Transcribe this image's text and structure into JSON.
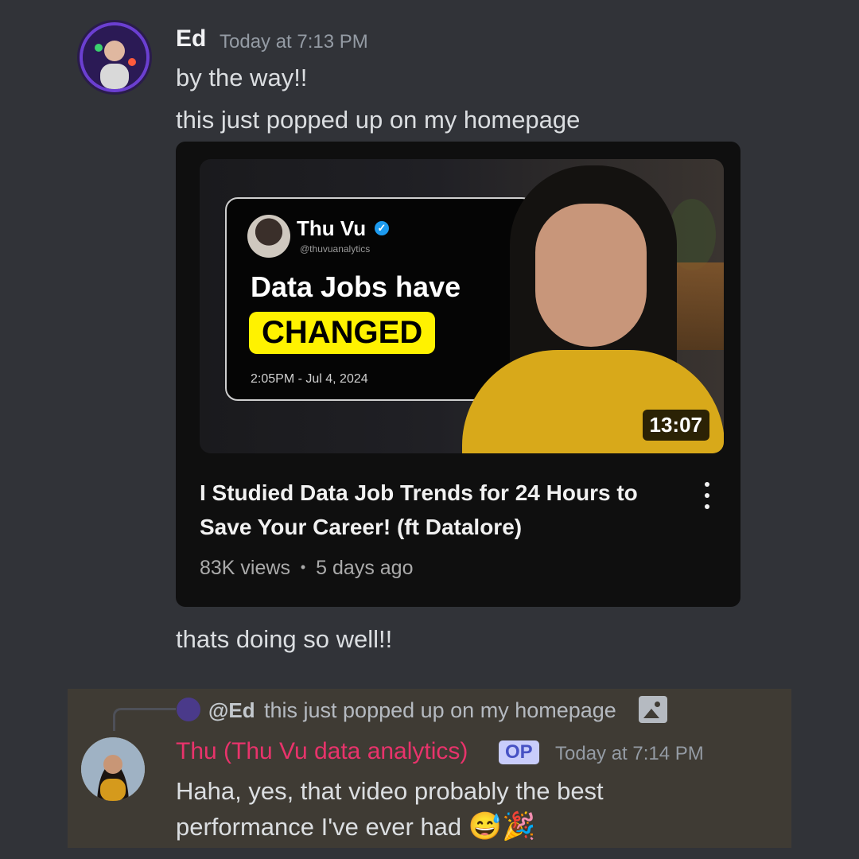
{
  "message1": {
    "author": "Ed",
    "timestamp": "Today at 7:13 PM",
    "lines": [
      "by the way!!",
      "this just popped up on my homepage"
    ],
    "after_embed": "thats doing so well!!"
  },
  "video_embed": {
    "thumbnail": {
      "card_name": "Thu Vu",
      "card_handle": "@thuvuanalytics",
      "card_headline": "Data Jobs have",
      "card_highlight": "CHANGED",
      "card_date": "2:05PM - Jul 4, 2024",
      "duration": "13:07"
    },
    "title": "I Studied Data Job Trends for 24 Hours to Save Your Career! (ft Datalore)",
    "views": "83K views",
    "separator": "•",
    "age": "5 days ago",
    "menu_icon": "more-vertical-icon"
  },
  "reply": {
    "referenced_user": "@Ed",
    "referenced_text": "this just popped up on my homepage",
    "referenced_attachment_icon": "image-icon",
    "author": "Thu (Thu Vu data analytics)",
    "op_tag": "OP",
    "timestamp": "Today at 7:14 PM",
    "body": "Haha,  yes, that video probably the best performance I've ever had",
    "emojis": [
      "😅",
      "🎉"
    ]
  },
  "colors": {
    "background": "#313338",
    "reply_highlight": "#3f3b34",
    "thu_name": "#e8336b",
    "op_tag_bg": "#c9cdfb",
    "thumbnail_highlight": "#fff200"
  }
}
